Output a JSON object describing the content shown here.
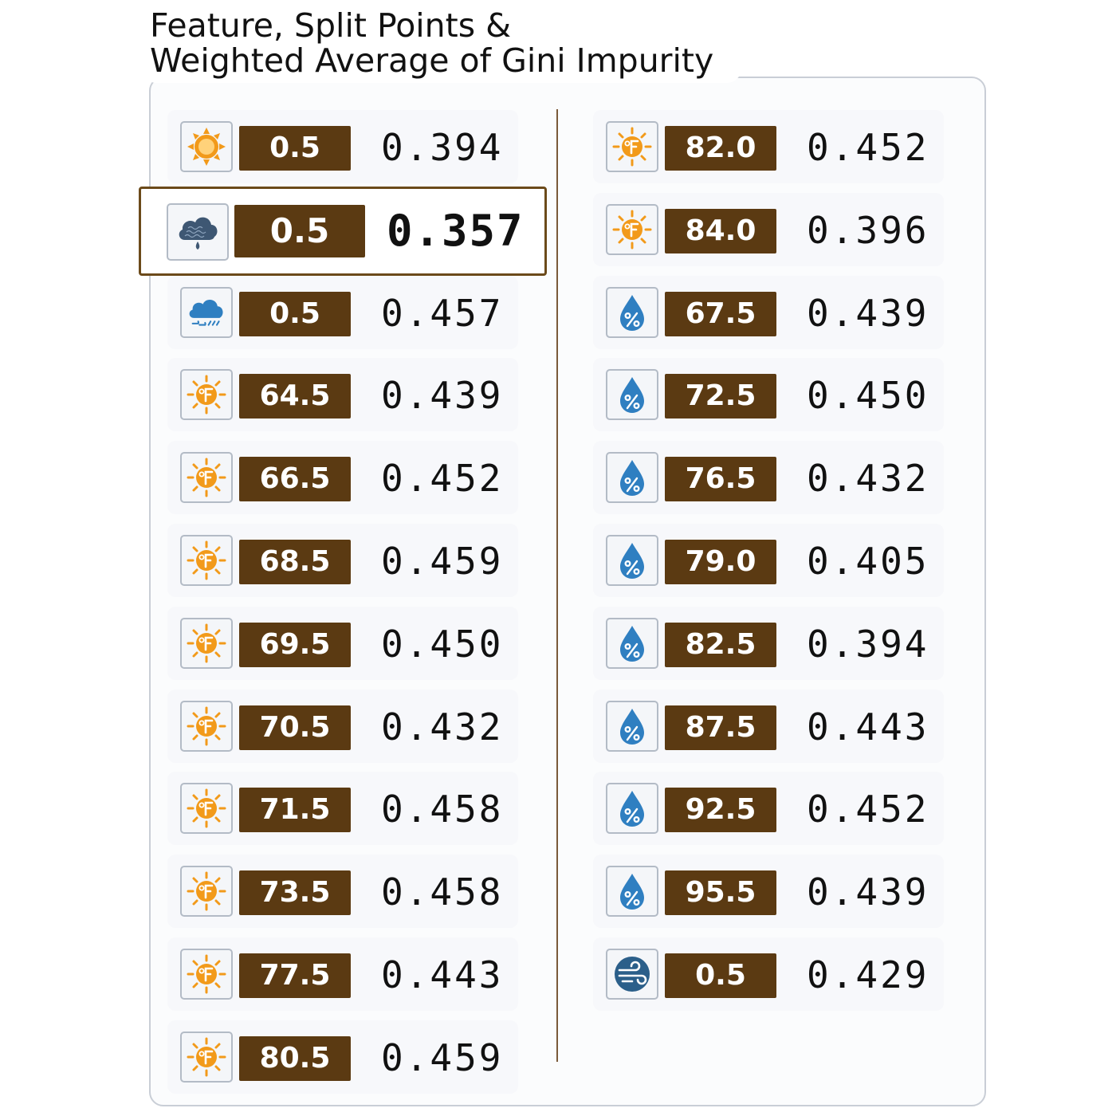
{
  "title": {
    "line1": "Feature, Split Points &",
    "line2": "Weighted Average of Gini Impurity"
  },
  "colors": {
    "split_box": "#5b3a12",
    "highlight_border": "#6b4a1a",
    "sun_orange": "#f29a1a",
    "humidity_blue": "#2f7fc1",
    "wind_blue": "#2b5f8a"
  },
  "best_split": {
    "feature": "overcast",
    "split": "0.5",
    "gini": "0.357"
  },
  "left_column": [
    {
      "feature": "sunny",
      "icon": "sun-icon",
      "split": "0.5",
      "gini": "0.394"
    },
    {
      "feature": "overcast",
      "icon": "cloud-drizzle-icon",
      "split": "0.5",
      "gini": "0.357",
      "best": true
    },
    {
      "feature": "rainy",
      "icon": "rain-cloud-icon",
      "split": "0.5",
      "gini": "0.457"
    },
    {
      "feature": "temperature",
      "icon": "temperature-fahrenheit-icon",
      "split": "64.5",
      "gini": "0.439"
    },
    {
      "feature": "temperature",
      "icon": "temperature-fahrenheit-icon",
      "split": "66.5",
      "gini": "0.452"
    },
    {
      "feature": "temperature",
      "icon": "temperature-fahrenheit-icon",
      "split": "68.5",
      "gini": "0.459"
    },
    {
      "feature": "temperature",
      "icon": "temperature-fahrenheit-icon",
      "split": "69.5",
      "gini": "0.450"
    },
    {
      "feature": "temperature",
      "icon": "temperature-fahrenheit-icon",
      "split": "70.5",
      "gini": "0.432"
    },
    {
      "feature": "temperature",
      "icon": "temperature-fahrenheit-icon",
      "split": "71.5",
      "gini": "0.458"
    },
    {
      "feature": "temperature",
      "icon": "temperature-fahrenheit-icon",
      "split": "73.5",
      "gini": "0.458"
    },
    {
      "feature": "temperature",
      "icon": "temperature-fahrenheit-icon",
      "split": "77.5",
      "gini": "0.443"
    },
    {
      "feature": "temperature",
      "icon": "temperature-fahrenheit-icon",
      "split": "80.5",
      "gini": "0.459"
    }
  ],
  "right_column": [
    {
      "feature": "temperature",
      "icon": "temperature-fahrenheit-icon",
      "split": "82.0",
      "gini": "0.452"
    },
    {
      "feature": "temperature",
      "icon": "temperature-fahrenheit-icon",
      "split": "84.0",
      "gini": "0.396"
    },
    {
      "feature": "humidity",
      "icon": "humidity-drop-icon",
      "split": "67.5",
      "gini": "0.439"
    },
    {
      "feature": "humidity",
      "icon": "humidity-drop-icon",
      "split": "72.5",
      "gini": "0.450"
    },
    {
      "feature": "humidity",
      "icon": "humidity-drop-icon",
      "split": "76.5",
      "gini": "0.432"
    },
    {
      "feature": "humidity",
      "icon": "humidity-drop-icon",
      "split": "79.0",
      "gini": "0.405"
    },
    {
      "feature": "humidity",
      "icon": "humidity-drop-icon",
      "split": "82.5",
      "gini": "0.394"
    },
    {
      "feature": "humidity",
      "icon": "humidity-drop-icon",
      "split": "87.5",
      "gini": "0.443"
    },
    {
      "feature": "humidity",
      "icon": "humidity-drop-icon",
      "split": "92.5",
      "gini": "0.452"
    },
    {
      "feature": "humidity",
      "icon": "humidity-drop-icon",
      "split": "95.5",
      "gini": "0.439"
    },
    {
      "feature": "wind",
      "icon": "wind-icon",
      "split": "0.5",
      "gini": "0.429"
    }
  ]
}
